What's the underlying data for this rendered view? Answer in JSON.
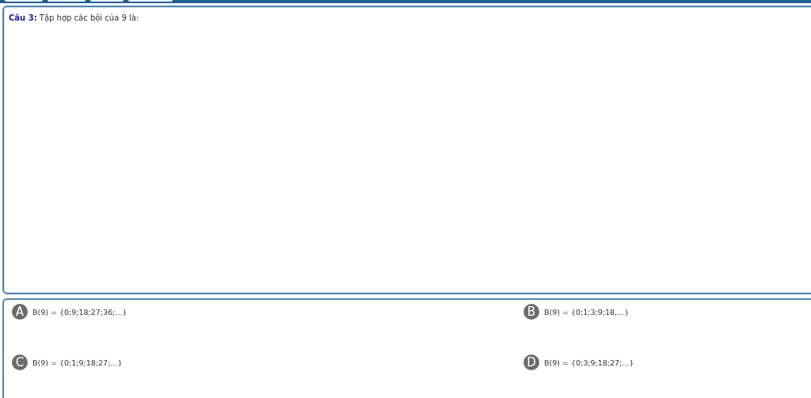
{
  "question": {
    "text": "**Câu 3:** Tập hợp các bội của 9 là:"
  },
  "answers": [
    {
      "letter": "A",
      "text": "B(9) = {0;9;18;27;36;...}"
    },
    {
      "letter": "B",
      "text": "B(9) = {0;1;3;9;18,...}"
    },
    {
      "letter": "C",
      "text": "B(9) = {0;1;9;18;27;...}"
    },
    {
      "letter": "D",
      "text": "B(9) = {0;3;9;18;27;...}"
    }
  ]
}
